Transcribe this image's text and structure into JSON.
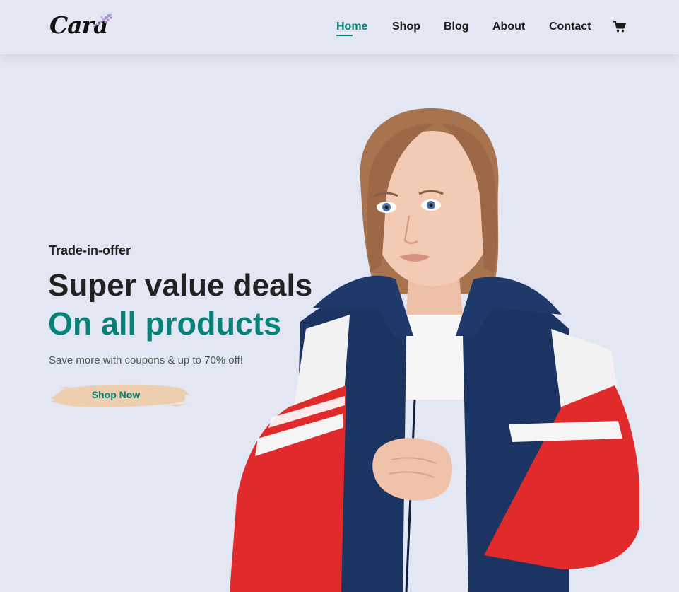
{
  "brand": {
    "name": "Cara"
  },
  "nav": {
    "items": [
      {
        "label": "Home",
        "active": true
      },
      {
        "label": "Shop",
        "active": false
      },
      {
        "label": "Blog",
        "active": false
      },
      {
        "label": "About",
        "active": false
      },
      {
        "label": "Contact",
        "active": false
      }
    ],
    "cart_icon": "shopping-cart-icon"
  },
  "hero": {
    "eyebrow": "Trade-in-offer",
    "title_line1": "Super value deals",
    "title_line2": "On all products",
    "subtitle": "Save more with coupons & up to 70% off!",
    "cta_label": "Shop Now",
    "image_description": "model"
  },
  "colors": {
    "background": "#e3e6f3",
    "accent": "#088178",
    "text_dark": "#222222",
    "button_paint": "#edcfb0"
  }
}
